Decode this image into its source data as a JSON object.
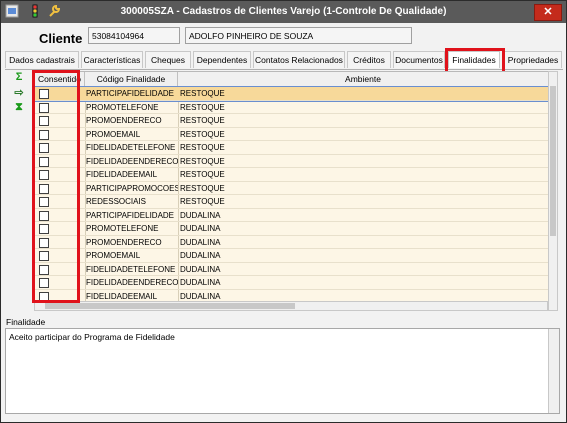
{
  "window": {
    "title": "300005SZA - Cadastros de Clientes Varejo (1-Controle De Qualidade)",
    "close_label": "✕"
  },
  "header": {
    "cliente_label": "Cliente",
    "codigo": "53084104964",
    "nome": "ADOLFO PINHEIRO DE SOUZA"
  },
  "tabs": [
    "Dados cadastrais",
    "Características",
    "Cheques",
    "Dependentes",
    "Contatos Relacionados",
    "Créditos",
    "Documentos",
    "Finalidades",
    "Propriedades"
  ],
  "active_tab": "Finalidades",
  "side_tools": {
    "sum": "Σ",
    "export": "⇨",
    "filter": "⧗"
  },
  "grid": {
    "columns": [
      "Consentido",
      "Código Finalidade",
      "Ambiente"
    ],
    "rows": [
      {
        "consentido": false,
        "codigo": "PARTICIPAFIDELIDADE",
        "ambiente": "RESTOQUE"
      },
      {
        "consentido": false,
        "codigo": "PROMOTELEFONE",
        "ambiente": "RESTOQUE"
      },
      {
        "consentido": false,
        "codigo": "PROMOENDERECO",
        "ambiente": "RESTOQUE"
      },
      {
        "consentido": false,
        "codigo": "PROMOEMAIL",
        "ambiente": "RESTOQUE"
      },
      {
        "consentido": false,
        "codigo": "FIDELIDADETELEFONE",
        "ambiente": "RESTOQUE"
      },
      {
        "consentido": false,
        "codigo": "FIDELIDADEENDERECO",
        "ambiente": "RESTOQUE"
      },
      {
        "consentido": false,
        "codigo": "FIDELIDADEEMAIL",
        "ambiente": "RESTOQUE"
      },
      {
        "consentido": false,
        "codigo": "PARTICIPAPROMOCOES",
        "ambiente": "RESTOQUE"
      },
      {
        "consentido": false,
        "codigo": "REDESSOCIAIS",
        "ambiente": "RESTOQUE"
      },
      {
        "consentido": false,
        "codigo": "PARTICIPAFIDELIDADE",
        "ambiente": "DUDALINA"
      },
      {
        "consentido": false,
        "codigo": "PROMOTELEFONE",
        "ambiente": "DUDALINA"
      },
      {
        "consentido": false,
        "codigo": "PROMOENDERECO",
        "ambiente": "DUDALINA"
      },
      {
        "consentido": false,
        "codigo": "PROMOEMAIL",
        "ambiente": "DUDALINA"
      },
      {
        "consentido": false,
        "codigo": "FIDELIDADETELEFONE",
        "ambiente": "DUDALINA"
      },
      {
        "consentido": false,
        "codigo": "FIDELIDADEENDERECO",
        "ambiente": "DUDALINA"
      },
      {
        "consentido": false,
        "codigo": "FIDELIDADEEMAIL",
        "ambiente": "DUDALINA"
      }
    ],
    "selected_row": 0
  },
  "finalidade": {
    "label": "Finalidade",
    "text": "Aceito participar do Programa de Fidelidade"
  },
  "colors": {
    "highlight": "#e0121b",
    "grid_bg": "#fdf6e6",
    "selected_row": "#f7d99a"
  }
}
